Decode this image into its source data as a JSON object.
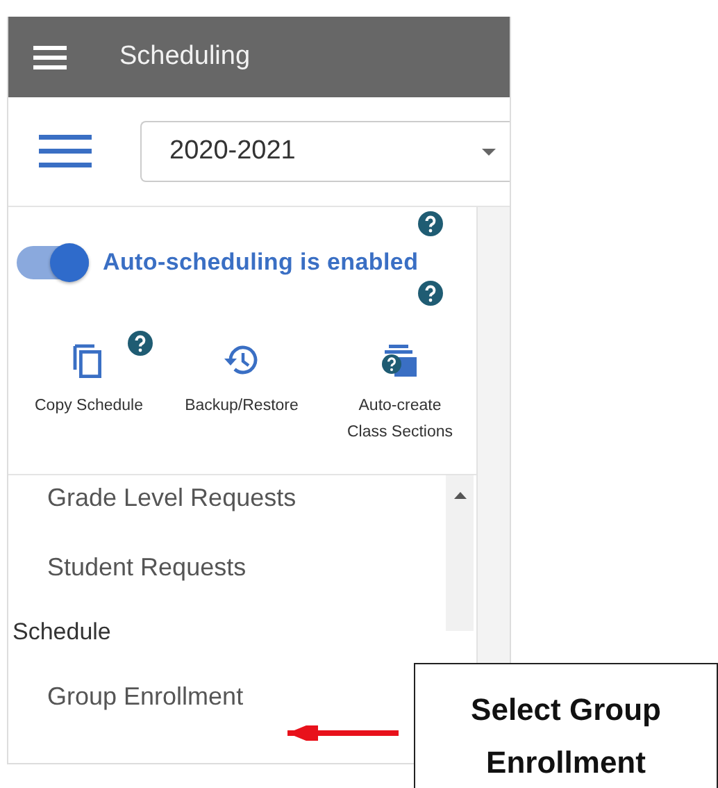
{
  "app_bar": {
    "title": "Scheduling"
  },
  "year_select": {
    "value": "2020-2021"
  },
  "auto_scheduling": {
    "on": true,
    "label": "Auto-scheduling is enabled"
  },
  "tools": [
    {
      "kind": "copy",
      "label": "Copy Schedule",
      "help": true
    },
    {
      "kind": "history",
      "label": "Backup/Restore",
      "help": false
    },
    {
      "kind": "sections",
      "label": "Auto-create Class Sections",
      "help": false
    }
  ],
  "menu": [
    {
      "kind": "item",
      "label": "Grade Level Requests"
    },
    {
      "kind": "item",
      "label": "Student Requests"
    },
    {
      "kind": "header",
      "label": "Schedule"
    },
    {
      "kind": "item",
      "label": "Group Enrollment"
    }
  ],
  "callout": {
    "text": "Select Group Enrollment"
  }
}
